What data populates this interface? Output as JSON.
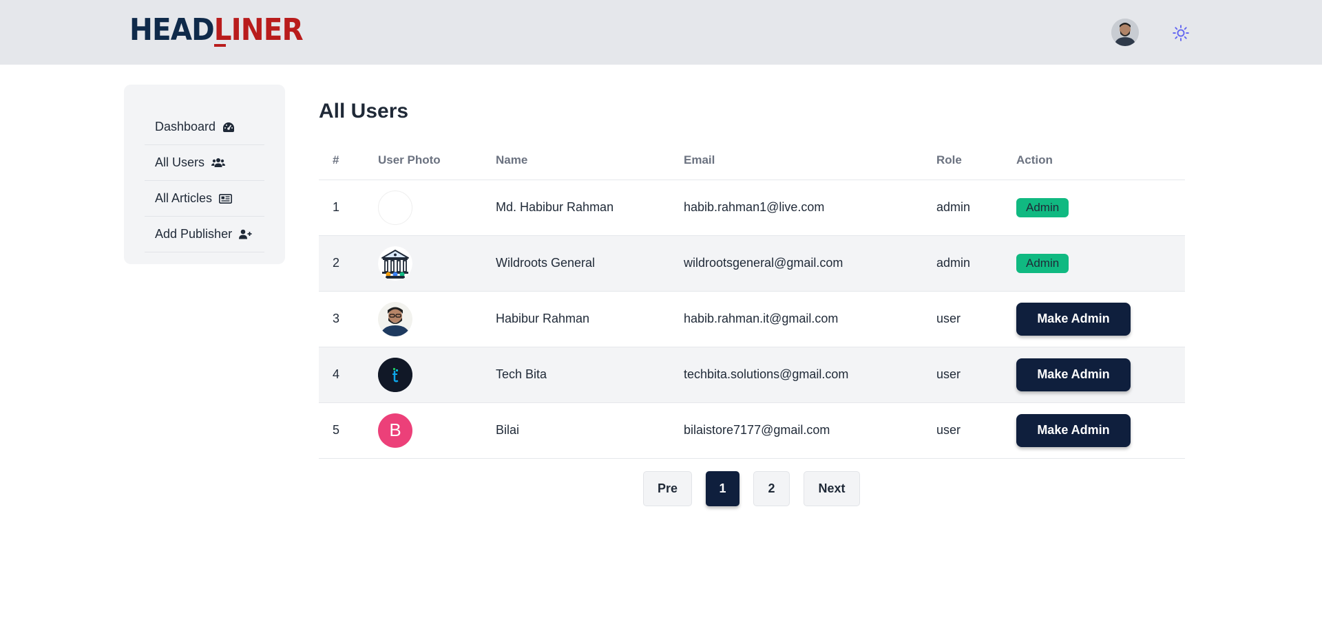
{
  "header": {
    "logo_head": "HEAD",
    "logo_liner": "LINER",
    "avatar": "user-avatar",
    "theme_icon": "sun-icon"
  },
  "sidebar": {
    "items": [
      {
        "label": "Dashboard",
        "icon": "gauge-icon"
      },
      {
        "label": "All Users",
        "icon": "users-icon"
      },
      {
        "label": "All Articles",
        "icon": "newspaper-icon"
      },
      {
        "label": "Add Publisher",
        "icon": "user-plus-icon"
      }
    ]
  },
  "main": {
    "title": "All Users",
    "columns": [
      "#",
      "User Photo",
      "Name",
      "Email",
      "Role",
      "Action"
    ],
    "rows": [
      {
        "num": "1",
        "name": "Md. Habibur Rahman",
        "email": "habib.rahman1@live.com",
        "role": "admin",
        "action": "Admin"
      },
      {
        "num": "2",
        "name": "Wildroots General",
        "email": "wildrootsgeneral@gmail.com",
        "role": "admin",
        "action": "Admin"
      },
      {
        "num": "3",
        "name": "Habibur Rahman",
        "email": "habib.rahman.it@gmail.com",
        "role": "user",
        "action": "Make Admin"
      },
      {
        "num": "4",
        "name": "Tech Bita",
        "email": "techbita.solutions@gmail.com",
        "role": "user",
        "action": "Make Admin"
      },
      {
        "num": "5",
        "name": "Bilai",
        "email": "bilaistore7177@gmail.com",
        "role": "user",
        "action": "Make Admin",
        "photo_letter": "B"
      }
    ]
  },
  "pagination": {
    "prev": "Pre",
    "pages": [
      "1",
      "2"
    ],
    "next": "Next",
    "current": "1"
  },
  "colors": {
    "navy": "#0f1f3d",
    "brand_red": "#b91c1c",
    "admin_badge": "#10b981",
    "avatar_pink": "#ec4079"
  }
}
